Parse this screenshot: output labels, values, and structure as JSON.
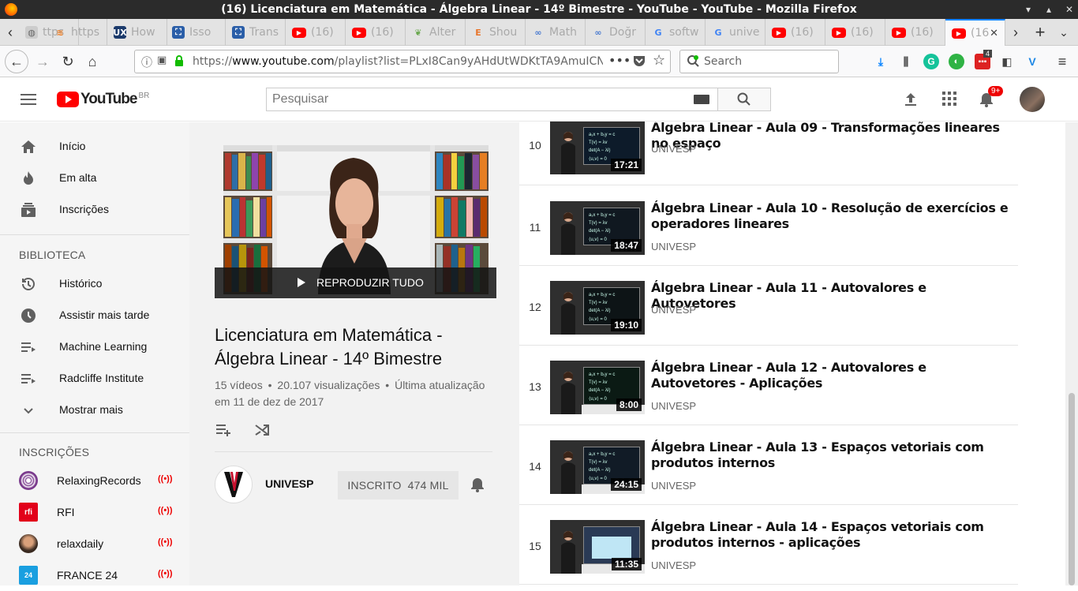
{
  "window": {
    "title": "(16) Licenciatura em Matemática - Álgebra Linear - 14º Bimestre - YouTube - YouTube - Mozilla Firefox"
  },
  "tabs": [
    {
      "label": "ttps",
      "icon": "globe-icon"
    },
    {
      "label": "https",
      "icon": "stackoverflow-icon"
    },
    {
      "label": "How",
      "icon": "ux-icon"
    },
    {
      "label": "Isso",
      "icon": "translate-icon"
    },
    {
      "label": "Trans",
      "icon": "translate-icon"
    },
    {
      "label": "(16)",
      "icon": "youtube-icon"
    },
    {
      "label": "(16)",
      "icon": "youtube-icon"
    },
    {
      "label": "Alter",
      "icon": "leaf-icon"
    },
    {
      "label": "Shou",
      "icon": "e-icon"
    },
    {
      "label": "Math",
      "icon": "link-icon"
    },
    {
      "label": "Doğr",
      "icon": "link-icon"
    },
    {
      "label": "softw",
      "icon": "google-icon"
    },
    {
      "label": "unive",
      "icon": "google-icon"
    },
    {
      "label": "(16)",
      "icon": "youtube-icon"
    },
    {
      "label": "(16)",
      "icon": "youtube-icon"
    },
    {
      "label": "(16)",
      "icon": "youtube-icon"
    },
    {
      "label": "(16",
      "icon": "youtube-icon"
    }
  ],
  "navbar": {
    "url_host": "www.youtube.com",
    "url_prefix": "https://",
    "url_path": "/playlist?list=PLxI8Can9yAHdUtWDKtTA9AmuICN",
    "search_placeholder": "Search",
    "badge_count": "4"
  },
  "yt": {
    "logo_text": "YouTube",
    "logo_country": "BR",
    "search_placeholder": "Pesquisar",
    "notif_count": "9+"
  },
  "sidebar": {
    "main": [
      {
        "label": "Início",
        "icon": "home-icon"
      },
      {
        "label": "Em alta",
        "icon": "flame-icon"
      },
      {
        "label": "Inscrições",
        "icon": "subscriptions-icon"
      }
    ],
    "library_heading": "BIBLIOTECA",
    "library": [
      {
        "label": "Histórico",
        "icon": "history-icon"
      },
      {
        "label": "Assistir mais tarde",
        "icon": "clock-icon"
      },
      {
        "label": "Machine Learning",
        "icon": "playlist-icon"
      },
      {
        "label": "Radcliffe Institute",
        "icon": "playlist-icon"
      },
      {
        "label": "Mostrar mais",
        "icon": "chevron-down-icon"
      }
    ],
    "subs_heading": "INSCRIÇÕES",
    "subs": [
      {
        "label": "RelaxingRecords",
        "icon": "relaxing-avatar",
        "color": "#7a3a8c"
      },
      {
        "label": "RFI",
        "icon": "rfi-avatar",
        "color": "#e2001a"
      },
      {
        "label": "relaxdaily",
        "icon": "relaxdaily-avatar",
        "color": "#6b4b3a"
      },
      {
        "label": "FRANCE 24",
        "icon": "france24-avatar",
        "color": "#1a9fe0"
      }
    ]
  },
  "playlist": {
    "play_all": "REPRODUZIR TUDO",
    "title": "Licenciatura em Matemática - Álgebra Linear - 14º Bimestre",
    "videos_count": "15 vídeos",
    "views": "20.107 visualizações",
    "updated_line1": "Última atualização",
    "updated_line2": "em 11 de dez de 2017",
    "dot": "•",
    "owner": "UNIVESP",
    "subscribed_label": "INSCRITO",
    "subscriber_count": "474 MIL"
  },
  "videos": [
    {
      "index": "10",
      "title": "Álgebra Linear - Aula 09 - Transformações lineares no espaço",
      "channel": "UNIVESP",
      "duration": "17:21"
    },
    {
      "index": "11",
      "title": "Álgebra Linear - Aula 10 - Resolução de exercícios e operadores lineares",
      "channel": "UNIVESP",
      "duration": "18:47"
    },
    {
      "index": "12",
      "title": "Álgebra Linear - Aula 11 - Autovalores e Autovetores",
      "channel": "UNIVESP",
      "duration": "19:10"
    },
    {
      "index": "13",
      "title": "Álgebra Linear - Aula 12 - Autovalores e Autovetores - Aplicações",
      "channel": "UNIVESP",
      "duration": "8:00"
    },
    {
      "index": "14",
      "title": "Álgebra Linear - Aula 13 - Espaços vetoriais com produtos internos",
      "channel": "UNIVESP",
      "duration": "24:15"
    },
    {
      "index": "15",
      "title": "Álgebra Linear - Aula 14 - Espaços vetoriais com produtos internos - aplicações",
      "channel": "UNIVESP",
      "duration": "11:35"
    }
  ],
  "colors": {
    "youtube_red": "#ff0000",
    "live_red": "#e00000",
    "firefox_blue": "#0a84ff"
  }
}
